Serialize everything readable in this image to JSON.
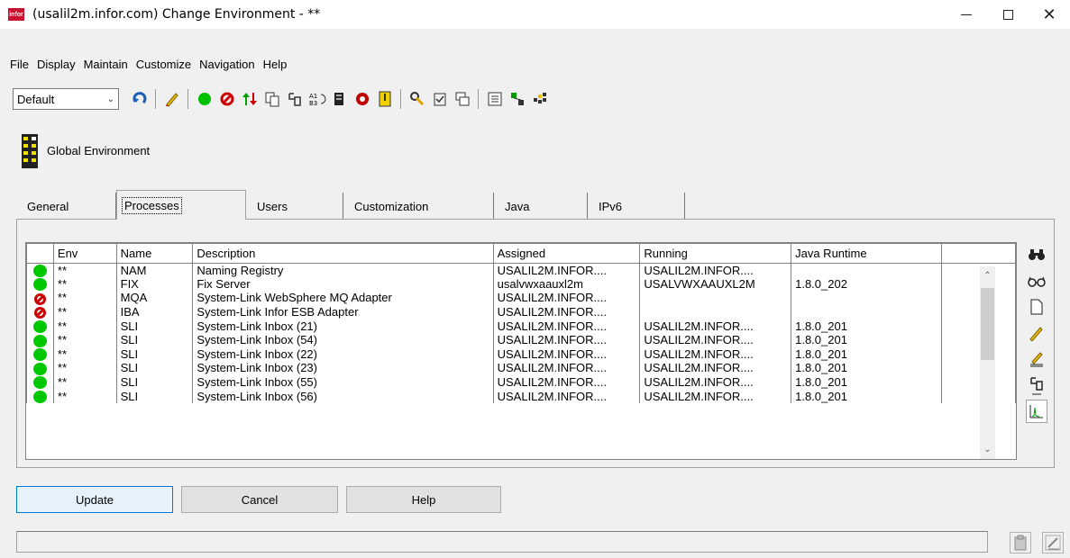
{
  "window": {
    "icon_text": "infor",
    "title": "(usalil2m.infor.com) Change Environment - **",
    "close_glyph": "✕"
  },
  "menu": [
    {
      "label": "File"
    },
    {
      "label": "Display"
    },
    {
      "label": "Maintain"
    },
    {
      "label": "Customize"
    },
    {
      "label": "Navigation"
    },
    {
      "label": "Help"
    }
  ],
  "toolbar": {
    "combo_value": "Default",
    "icons": [
      "refresh-icon",
      "edit-pencil-icon",
      "start-green-icon",
      "stop-icon",
      "move-arrows-icon",
      "copy-icon",
      "plug-icon",
      "sort-icon",
      "server-icon",
      "alarm-icon",
      "yellow-doc-icon",
      "tools-icon",
      "checklist-icon",
      "windows-icon",
      "list-icon",
      "network-icon",
      "grid-icon"
    ]
  },
  "global": {
    "label": "Global Environment"
  },
  "tabs": [
    {
      "label": "General"
    },
    {
      "label": "Processes"
    },
    {
      "label": "Users"
    },
    {
      "label": "Customization"
    },
    {
      "label": "Java"
    },
    {
      "label": "IPv6"
    }
  ],
  "table": {
    "headers": {
      "env": "Env",
      "name": "Name",
      "description": "Description",
      "assigned": "Assigned",
      "running": "Running",
      "java": "Java Runtime"
    },
    "rows": [
      {
        "status": "running",
        "env": "**",
        "name": "NAM",
        "description": "Naming Registry",
        "assigned": "USALIL2M.INFOR....",
        "running": "USALIL2M.INFOR....",
        "java": ""
      },
      {
        "status": "running",
        "env": "**",
        "name": "FIX",
        "description": "Fix Server",
        "assigned": "usalvwxaauxl2m",
        "running": "USALVWXAAUXL2M",
        "java": "1.8.0_202"
      },
      {
        "status": "stopped",
        "env": "**",
        "name": "MQA",
        "description": "System-Link WebSphere MQ Adapter",
        "assigned": "USALIL2M.INFOR....",
        "running": "",
        "java": ""
      },
      {
        "status": "stopped",
        "env": "**",
        "name": "IBA",
        "description": "System-Link Infor ESB Adapter",
        "assigned": "USALIL2M.INFOR....",
        "running": "",
        "java": ""
      },
      {
        "status": "running",
        "env": "**",
        "name": "SLI",
        "description": "System-Link Inbox (21)",
        "assigned": "USALIL2M.INFOR....",
        "running": "USALIL2M.INFOR....",
        "java": "1.8.0_201"
      },
      {
        "status": "running",
        "env": "**",
        "name": "SLI",
        "description": "System-Link Inbox (54)",
        "assigned": "USALIL2M.INFOR....",
        "running": "USALIL2M.INFOR....",
        "java": "1.8.0_201"
      },
      {
        "status": "running",
        "env": "**",
        "name": "SLI",
        "description": "System-Link Inbox (22)",
        "assigned": "USALIL2M.INFOR....",
        "running": "USALIL2M.INFOR....",
        "java": "1.8.0_201"
      },
      {
        "status": "running",
        "env": "**",
        "name": "SLI",
        "description": "System-Link Inbox (23)",
        "assigned": "USALIL2M.INFOR....",
        "running": "USALIL2M.INFOR....",
        "java": "1.8.0_201"
      },
      {
        "status": "running",
        "env": "**",
        "name": "SLI",
        "description": "System-Link Inbox (55)",
        "assigned": "USALIL2M.INFOR....",
        "running": "USALIL2M.INFOR....",
        "java": "1.8.0_201"
      },
      {
        "status": "running",
        "env": "**",
        "name": "SLI",
        "description": "System-Link Inbox (56)",
        "assigned": "USALIL2M.INFOR....",
        "running": "USALIL2M.INFOR....",
        "java": "1.8.0_201"
      }
    ]
  },
  "side_tools": [
    "binoculars-icon",
    "glasses-icon",
    "new-document-icon",
    "pencil-icon",
    "edit-lines-icon",
    "plug-icon",
    "chart-icon"
  ],
  "buttons": {
    "update": "Update",
    "cancel": "Cancel",
    "help": "Help"
  },
  "status": {
    "text": ""
  }
}
